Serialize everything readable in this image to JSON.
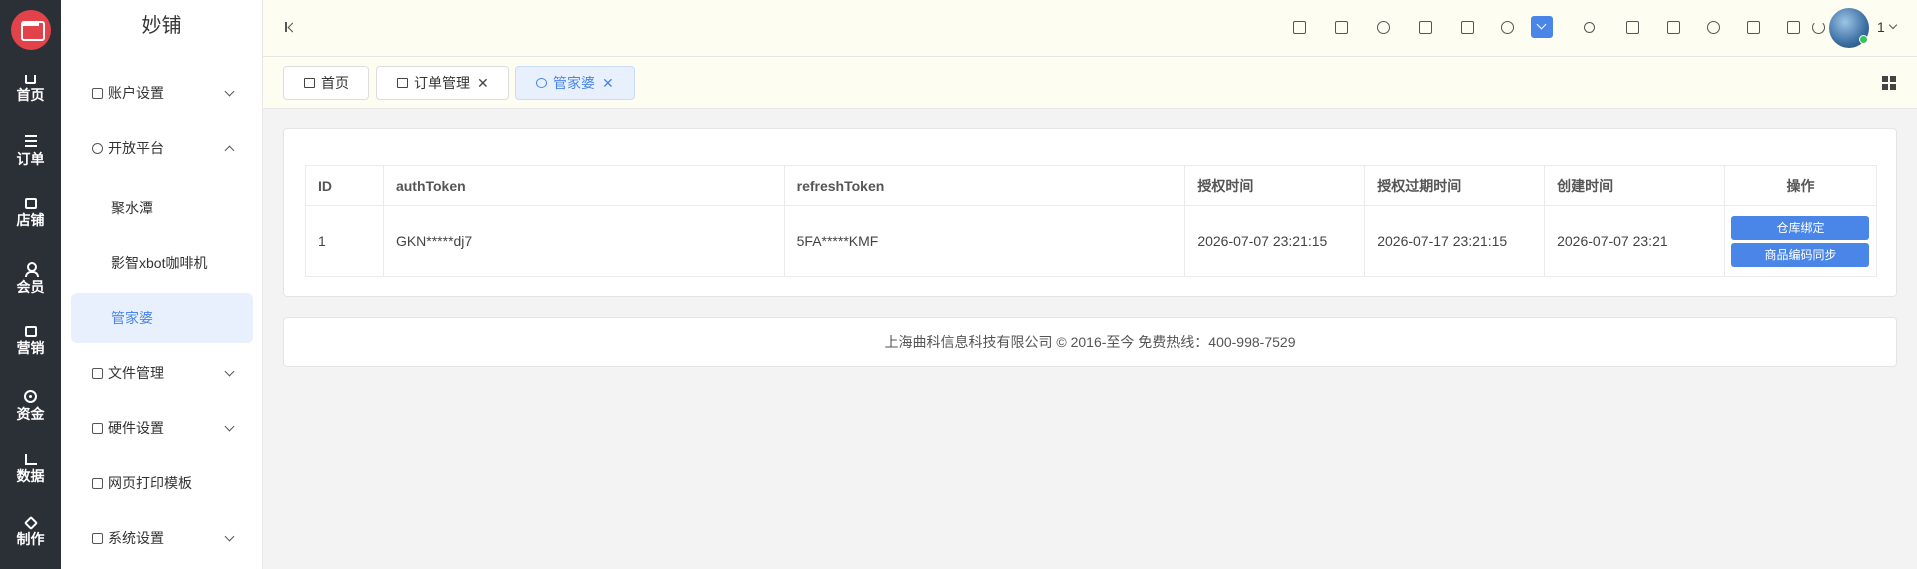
{
  "rail": {
    "items": [
      {
        "label": "首页",
        "icon": "home-icon"
      },
      {
        "label": "订单",
        "icon": "list-icon"
      },
      {
        "label": "店铺",
        "icon": "shop-icon"
      },
      {
        "label": "会员",
        "icon": "user-icon"
      },
      {
        "label": "营销",
        "icon": "gift-icon"
      },
      {
        "label": "资金",
        "icon": "coin-icon"
      },
      {
        "label": "数据",
        "icon": "chart-icon"
      },
      {
        "label": "制作",
        "icon": "cube-icon"
      }
    ]
  },
  "sidebar": {
    "brand": "妙铺",
    "menu": [
      {
        "label": "账户设置"
      },
      {
        "label": "开放平台"
      },
      {
        "label": "文件管理"
      },
      {
        "label": "硬件设置"
      },
      {
        "label": "网页打印模板"
      },
      {
        "label": "系统设置"
      }
    ],
    "sub": [
      {
        "label": "聚水潭"
      },
      {
        "label": "影智xbot咖啡机"
      },
      {
        "label": "管家婆"
      }
    ]
  },
  "header": {
    "user_name": "1"
  },
  "tabs": [
    {
      "label": "首页"
    },
    {
      "label": "订单管理",
      "close": "✕"
    },
    {
      "label": "管家婆",
      "close": "✕"
    }
  ],
  "table": {
    "headers": [
      "ID",
      "authToken",
      "refreshToken",
      "授权时间",
      "授权过期时间",
      "创建时间",
      "操作"
    ],
    "rows": [
      {
        "id": "1",
        "authToken": "GKN*****dj7",
        "refreshToken": "5FA*****KMF",
        "auth_time": "2026-07-07 23:21:15",
        "expire_time": "2026-07-17 23:21:15",
        "create_time": "2026-07-07 23:21",
        "actions": [
          "仓库绑定",
          "商品编码同步"
        ]
      }
    ]
  },
  "footer": {
    "text": "上海曲科信息科技有限公司 © 2016-至今 免费热线：400-998-7529"
  },
  "colors": {
    "primary": "#4a86e8",
    "rail_bg": "#2b2f36",
    "logo": "#e2434a"
  }
}
